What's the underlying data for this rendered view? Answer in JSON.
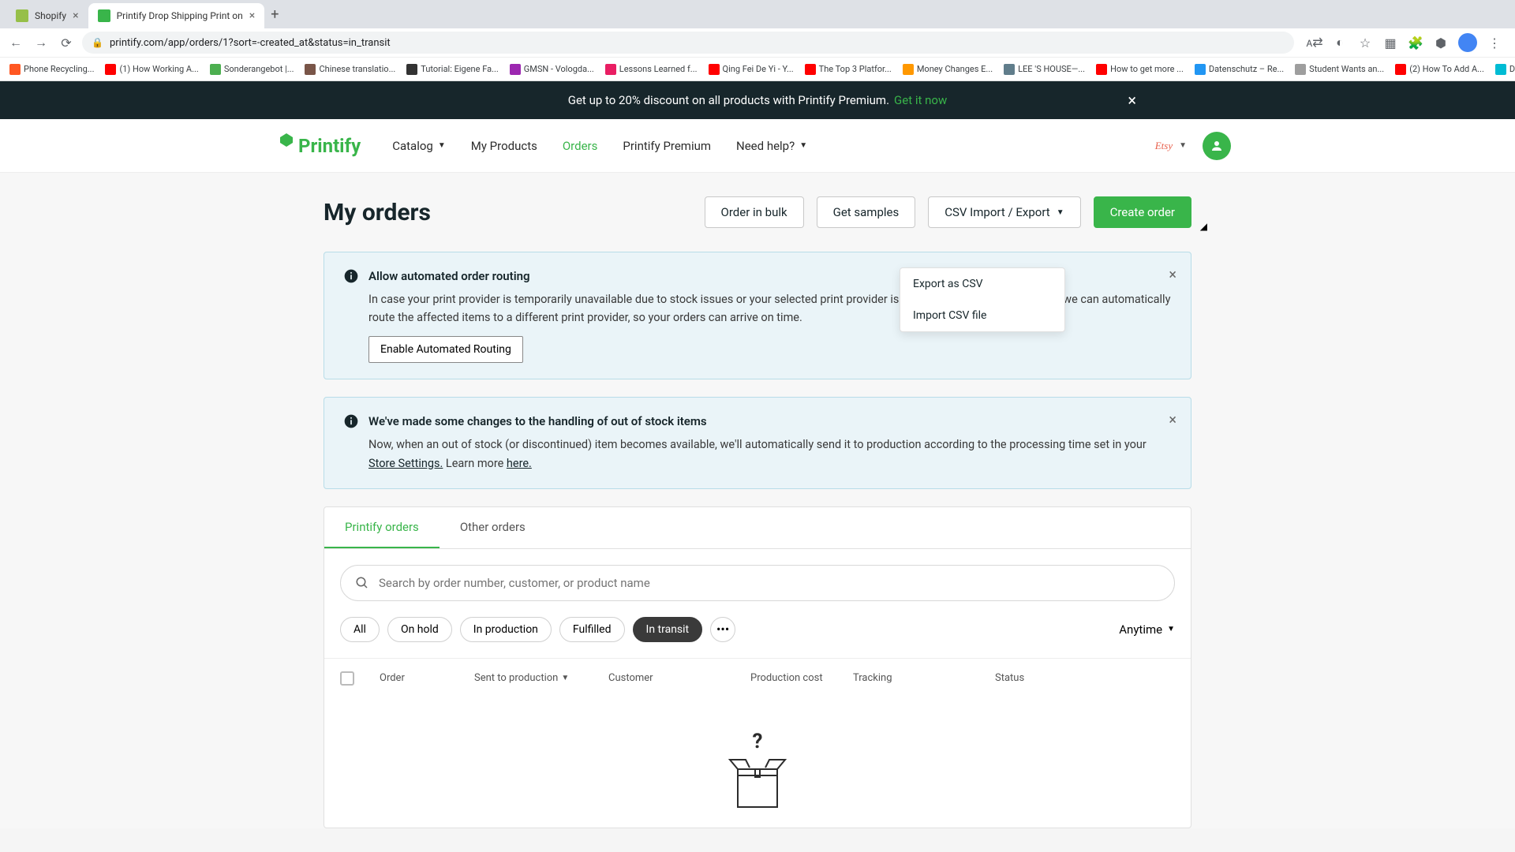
{
  "browser": {
    "tabs": [
      {
        "label": "Shopify",
        "favicon": "#96bf48"
      },
      {
        "label": "Printify Drop Shipping Print on",
        "favicon": "#39b54a"
      }
    ],
    "url": "printify.com/app/orders/1?sort=-created_at&status=in_transit",
    "bookmarks": [
      {
        "label": "Phone Recycling...",
        "color": "#ff5722"
      },
      {
        "label": "(1) How Working A...",
        "color": "#ff0000"
      },
      {
        "label": "Sonderangebot |...",
        "color": "#4caf50"
      },
      {
        "label": "Chinese translatio...",
        "color": "#795548"
      },
      {
        "label": "Tutorial: Eigene Fa...",
        "color": "#333333"
      },
      {
        "label": "GMSN - Vologda...",
        "color": "#9c27b0"
      },
      {
        "label": "Lessons Learned f...",
        "color": "#e91e63"
      },
      {
        "label": "Qing Fei De Yi - Y...",
        "color": "#ff0000"
      },
      {
        "label": "The Top 3 Platfor...",
        "color": "#ff0000"
      },
      {
        "label": "Money Changes E...",
        "color": "#ff9800"
      },
      {
        "label": "LEE 'S HOUSE—...",
        "color": "#607d8b"
      },
      {
        "label": "How to get more ...",
        "color": "#ff0000"
      },
      {
        "label": "Datenschutz – Re...",
        "color": "#2196f3"
      },
      {
        "label": "Student Wants an...",
        "color": "#9e9e9e"
      },
      {
        "label": "(2) How To Add A...",
        "color": "#ff0000"
      },
      {
        "label": "Download - Cooki...",
        "color": "#00bcd4"
      }
    ]
  },
  "promo": {
    "text": "Get up to 20% discount on all products with Printify Premium.",
    "link": "Get it now"
  },
  "nav": {
    "logo": "Printify",
    "items": [
      "Catalog",
      "My Products",
      "Orders",
      "Printify Premium",
      "Need help?"
    ],
    "activeIndex": 2,
    "store": "Etsy"
  },
  "page": {
    "title": "My orders",
    "actions": {
      "bulk": "Order in bulk",
      "samples": "Get samples",
      "csv": "CSV Import / Export",
      "create": "Create order"
    },
    "csvMenu": [
      "Export as CSV",
      "Import CSV file"
    ]
  },
  "alerts": {
    "routing": {
      "title": "Allow automated order routing",
      "body": "In case your print provider is temporarily unavailable due to stock issues or your selected print provider is experiencing significant delays, we can automatically route the affected items to a different print provider, so your orders can arrive on time.",
      "button": "Enable Automated Routing"
    },
    "stock": {
      "title": "We've made some changes to the handling of out of stock items",
      "body_pre": "Now, when an out of stock (or discontinued) item becomes available, we'll automatically send it to production according to the processing time set in your ",
      "link1": "Store Settings.",
      "body_mid": " Learn more ",
      "link2": "here."
    }
  },
  "orders": {
    "tabs": [
      "Printify orders",
      "Other orders"
    ],
    "activeTab": 0,
    "searchPlaceholder": "Search by order number, customer, or product name",
    "filters": [
      "All",
      "On hold",
      "In production",
      "Fulfilled",
      "In transit"
    ],
    "activeFilter": 4,
    "timeFilter": "Anytime",
    "columns": [
      "Order",
      "Sent to production",
      "Customer",
      "Production cost",
      "Tracking",
      "Status"
    ]
  }
}
